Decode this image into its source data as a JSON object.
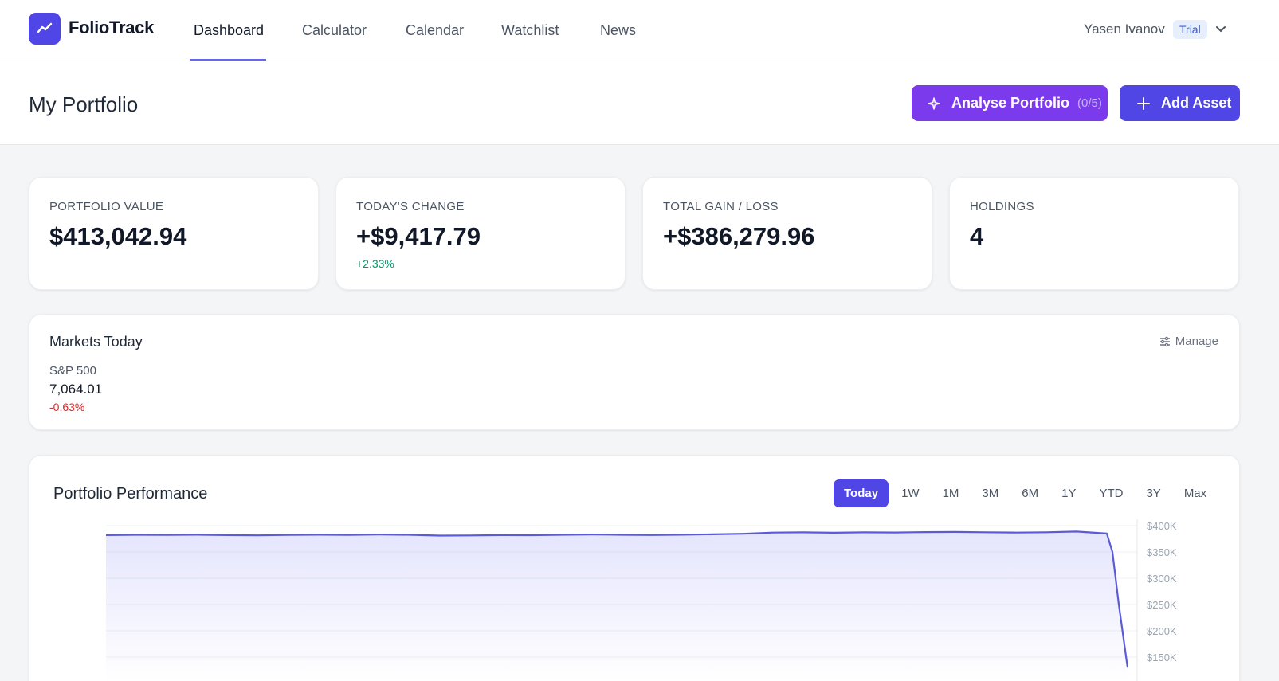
{
  "app": {
    "name": "FolioTrack",
    "nav": [
      "Dashboard",
      "Calculator",
      "Calendar",
      "Watchlist",
      "News"
    ],
    "active_nav": "Dashboard",
    "user": {
      "name": "Yasen Ivanov",
      "plan_badge": "Trial"
    }
  },
  "header": {
    "title": "My Portfolio",
    "analyse_label": "Analyse Portfolio",
    "analyse_count": "(0/5)",
    "add_label": "Add Asset"
  },
  "stats": [
    {
      "label": "PORTFOLIO VALUE",
      "value": "$413,042.94",
      "sub": ""
    },
    {
      "label": "TODAY'S CHANGE",
      "value": "+$9,417.79",
      "sub": "+2.33%"
    },
    {
      "label": "TOTAL GAIN / LOSS",
      "value": "+$386,279.96",
      "sub": ""
    },
    {
      "label": "HOLDINGS",
      "value": "4",
      "sub": ""
    }
  ],
  "markets": {
    "title": "Markets Today",
    "manage_label": "Manage",
    "items": [
      {
        "name": "S&P 500",
        "value": "7,064.01",
        "change": "-0.63%"
      }
    ]
  },
  "performance": {
    "title": "Portfolio Performance",
    "ranges": [
      "Today",
      "1W",
      "1M",
      "3M",
      "6M",
      "1Y",
      "YTD",
      "3Y",
      "Max"
    ],
    "active_range": "Today"
  },
  "colors": {
    "accent": "#4f46e5",
    "analyse": "#7c3aed",
    "positive": "#059669",
    "negative": "#dc2626"
  },
  "chart_data": {
    "type": "area",
    "title": "Portfolio Performance",
    "ytick_labels": [
      "$400K",
      "$350K",
      "$300K",
      "$250K",
      "$200K",
      "$150K"
    ],
    "yticks": [
      400000,
      350000,
      300000,
      250000,
      200000,
      150000
    ],
    "ylim": [
      130000,
      415000
    ],
    "grid": true,
    "series": [
      {
        "values": [
          382000,
          382500,
          382300,
          382800,
          382000,
          381500,
          382200,
          382700,
          382400,
          383000,
          382500,
          381000,
          381400,
          382000,
          381800,
          382500,
          383200,
          382600,
          382100,
          382800,
          383500,
          384500,
          386800,
          387200,
          386500,
          387300,
          386900,
          387800,
          388000,
          387500,
          386800,
          387400,
          388800,
          385000,
          350000,
          250000,
          130000
        ]
      }
    ]
  }
}
